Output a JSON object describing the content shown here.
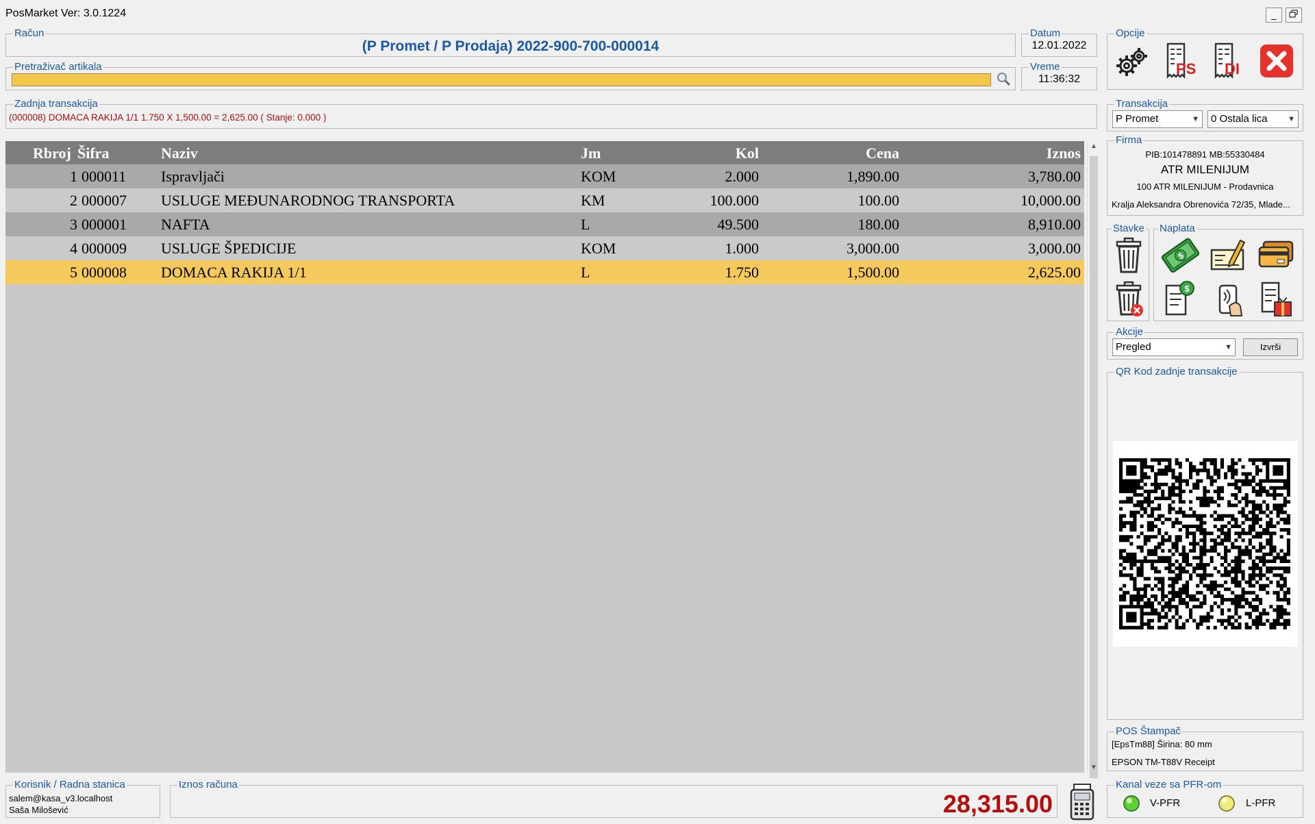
{
  "app": {
    "title": "PosMarket Ver: 3.0.1224"
  },
  "racun": {
    "legend": "Račun",
    "value": "(P Promet / P Prodaja) 2022-900-700-000014"
  },
  "datum": {
    "legend": "Datum",
    "value": "12.01.2022"
  },
  "vreme": {
    "legend": "Vreme",
    "value": "11:36:32"
  },
  "search": {
    "legend": "Pretraživač artikala",
    "value": ""
  },
  "last_tx": {
    "legend": "Zadnja transakcija",
    "value": "(000008) DOMACA RAKIJA 1/1 1.750 X 1,500.00 = 2,625.00 ( Stanje: 0.000 )"
  },
  "table": {
    "headers": {
      "rbroj": "Rbroj",
      "sifra": "Šifra",
      "naziv": "Naziv",
      "jm": "Jm",
      "kol": "Kol",
      "cena": "Cena",
      "iznos": "Iznos"
    },
    "rows": [
      {
        "rbroj": "1",
        "sifra": "000011",
        "naziv": "Ispravljači",
        "jm": "KOM",
        "kol": "2.000",
        "cena": "1,890.00",
        "iznos": "3,780.00"
      },
      {
        "rbroj": "2",
        "sifra": "000007",
        "naziv": "USLUGE MEĐUNARODNOG TRANSPORTA",
        "jm": "KM",
        "kol": "100.000",
        "cena": "100.00",
        "iznos": "10,000.00"
      },
      {
        "rbroj": "3",
        "sifra": "000001",
        "naziv": "NAFTA",
        "jm": "L",
        "kol": "49.500",
        "cena": "180.00",
        "iznos": "8,910.00"
      },
      {
        "rbroj": "4",
        "sifra": "000009",
        "naziv": "USLUGE ŠPEDICIJE",
        "jm": "KOM",
        "kol": "1.000",
        "cena": "3,000.00",
        "iznos": "3,000.00"
      },
      {
        "rbroj": "5",
        "sifra": "000008",
        "naziv": "DOMACA RAKIJA 1/1",
        "jm": "L",
        "kol": "1.750",
        "cena": "1,500.00",
        "iznos": "2,625.00"
      }
    ],
    "selected_row": 5
  },
  "opcije": {
    "legend": "Opcije",
    "ps_label": "PS",
    "di_label": "DI"
  },
  "transakcija": {
    "legend": "Transakcija",
    "type": "P Promet",
    "party": "0 Ostala lica"
  },
  "firma": {
    "legend": "Firma",
    "pib": "PIB:101478891 MB:55330484",
    "name": "ATR MILENIJUM",
    "store": "100 ATR MILENIJUM - Prodavnica",
    "address": "Kralja Aleksandra Obrenovića 72/35, Mlade..."
  },
  "stavke": {
    "legend": "Stavke"
  },
  "naplata": {
    "legend": "Naplata"
  },
  "akcije": {
    "legend": "Akcije",
    "selected": "Pregled",
    "execute_label": "Izvrši"
  },
  "qr": {
    "legend": "QR Kod zadnje transakcije"
  },
  "printer": {
    "legend": "POS Štampač",
    "line1": "[EpsTm88] Širina: 80 mm",
    "line2": "EPSON TM-T88V Receipt"
  },
  "user": {
    "legend": "Korisnik / Radna stanica",
    "login": "salem@kasa_v3.localhost",
    "name": "Saša Milošević"
  },
  "total": {
    "legend": "Iznos računa",
    "value": "28,315.00"
  },
  "pfr": {
    "legend": "Kanal veze sa PFR-om",
    "v_label": "V-PFR",
    "l_label": "L-PFR"
  },
  "colors": {
    "accent_blue": "#1a58a8",
    "selected_row": "#f5c95c",
    "total_red": "#b50c0c",
    "close_red": "#e5312b"
  }
}
